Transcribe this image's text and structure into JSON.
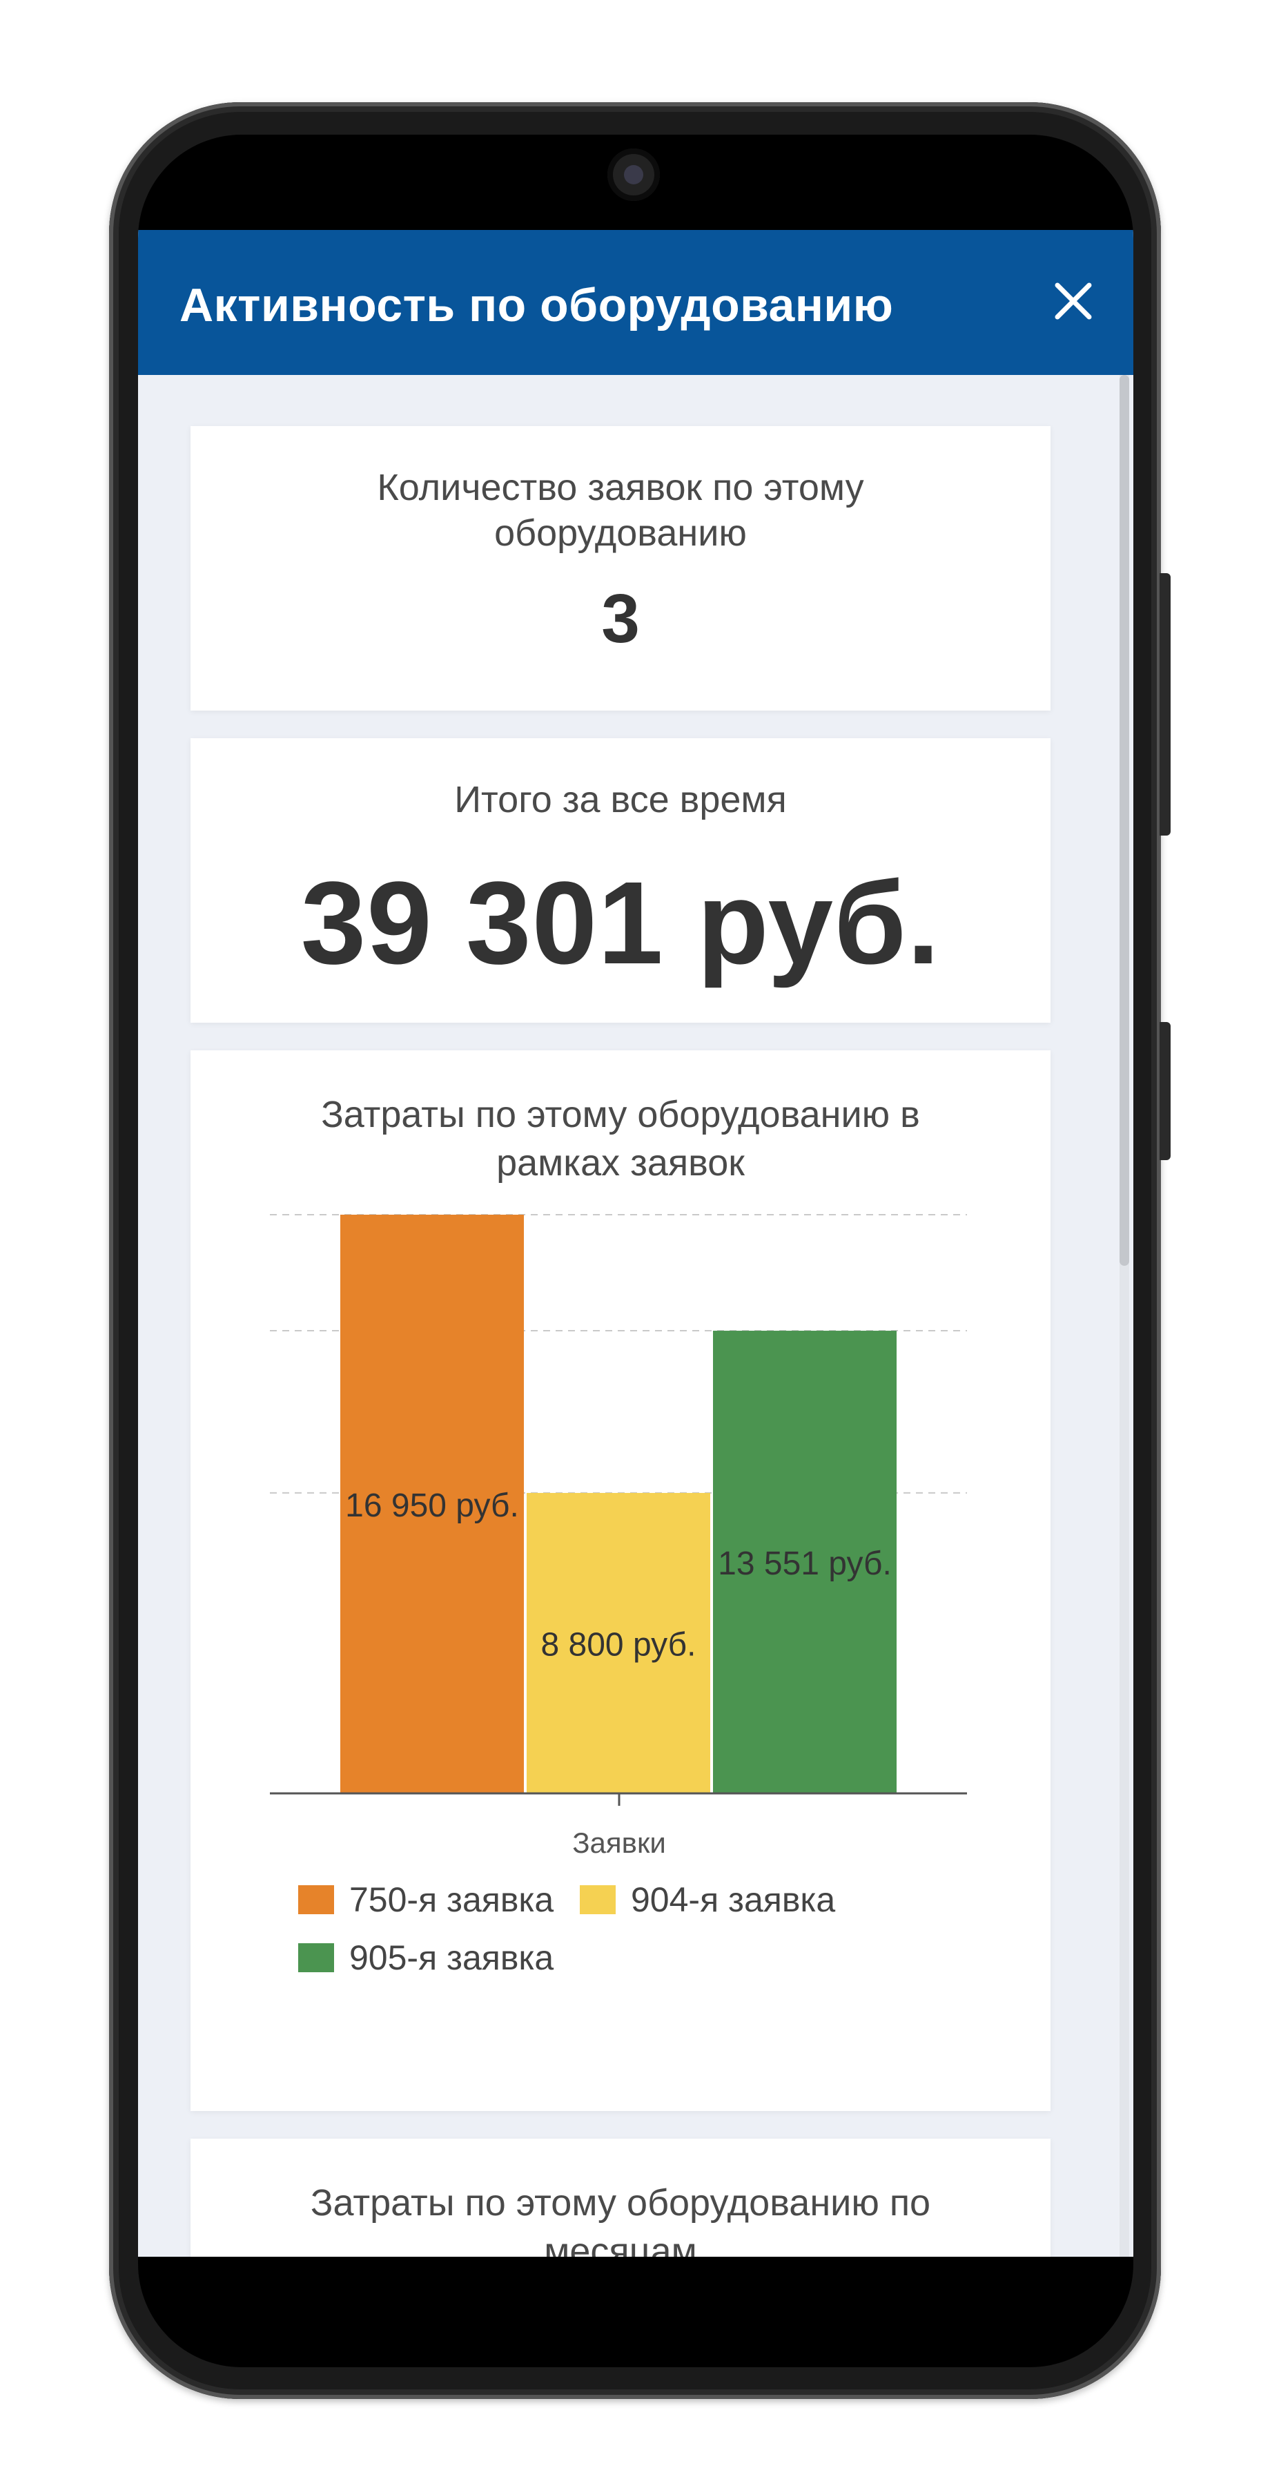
{
  "header": {
    "title": "Активность по оборудованию",
    "close_label": "×"
  },
  "cards": {
    "requests_count": {
      "label": "Количество заявок по этому оборудованию",
      "value": "3"
    },
    "total": {
      "label": "Итого за все время",
      "value": "39 301 руб."
    },
    "costs_by_request": {
      "label": "Затраты по этому оборудованию в рамках заявок"
    },
    "costs_by_month": {
      "label": "Затраты по этому оборудованию по месяцам"
    }
  },
  "chart_data": {
    "type": "bar",
    "xlabel": "Заявки",
    "categories": [
      "Заявки"
    ],
    "ylim": [
      0,
      16950
    ],
    "grid": true,
    "legend_position": "bottom",
    "series": [
      {
        "name": "750-я заявка",
        "values": [
          16950
        ],
        "label": "16 950 руб.",
        "color": "#e6832a"
      },
      {
        "name": "904-я заявка",
        "values": [
          8800
        ],
        "label": "8 800 руб.",
        "color": "#f5d152"
      },
      {
        "name": "905-я заявка",
        "values": [
          13551
        ],
        "label": "13 551 руб.",
        "color": "#4b9450"
      }
    ]
  }
}
